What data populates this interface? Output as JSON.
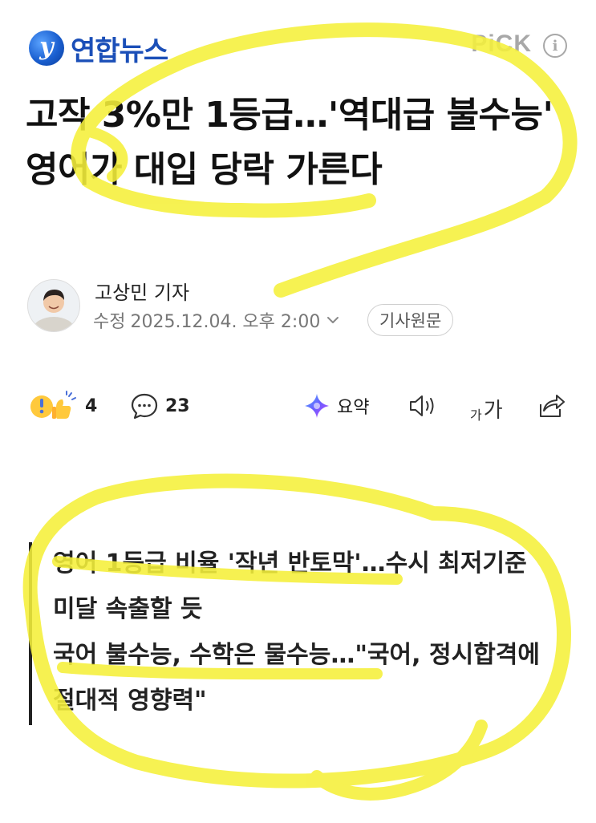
{
  "header": {
    "logo_letter": "y",
    "logo_text": "연합뉴스",
    "pick_label": "PiCK",
    "info_symbol": "i"
  },
  "article": {
    "headline": "고작 3%만 1등급…'역대급 불수능' 영어가 대입 당락 가른다",
    "reporter": "고상민 기자",
    "modified_label": "수정",
    "modified_datetime": "2025.12.04. 오후 2:00",
    "original_button": "기사원문"
  },
  "actions": {
    "reaction_count": "4",
    "comment_count": "23",
    "summary_label": "요약",
    "font_small": "가",
    "font_large": "가"
  },
  "summary": {
    "lines": [
      "영어 1등급 비율 '작년 반토막'…수시 최저기준 미달 속출할 듯",
      "국어 불수능, 수학은 물수능…\"국어, 정시합격에 절대적 영향력\""
    ]
  },
  "colors": {
    "logo_blue": "#1b4fb8",
    "highlighter": "#f5f03a",
    "muted": "#777777"
  }
}
